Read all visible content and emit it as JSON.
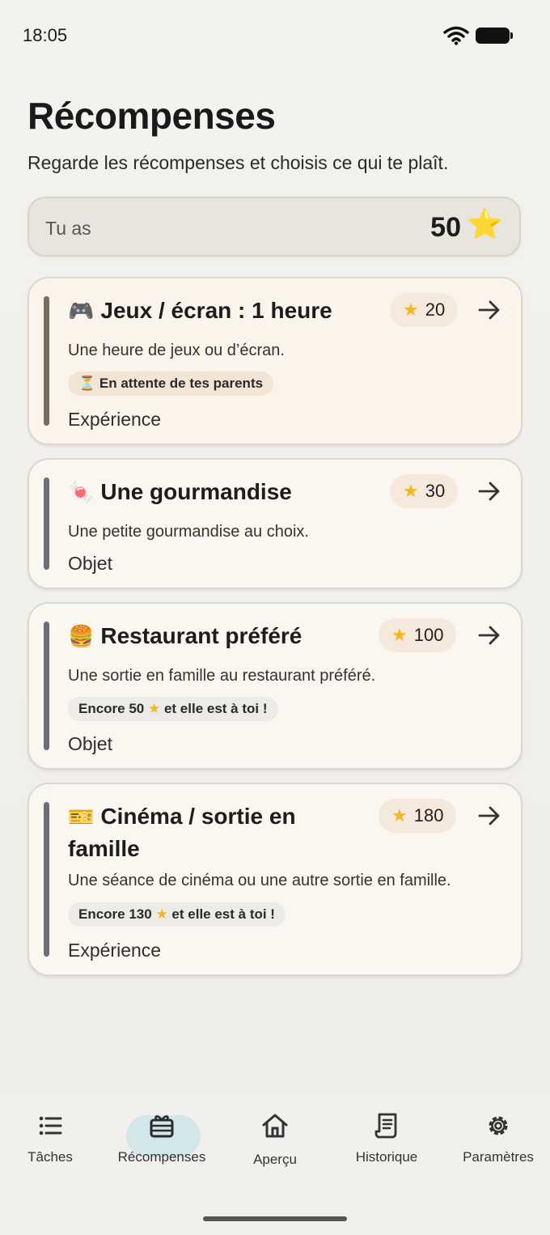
{
  "status_bar": {
    "time": "18:05"
  },
  "header": {
    "title": "Récompenses",
    "subtitle": "Regarde les récompenses et choisis ce qui te plaît."
  },
  "balance": {
    "label": "Tu as",
    "value": "50",
    "star": "⭐"
  },
  "rewards": [
    {
      "emoji": "🎮",
      "title": "Jeux / écran : 1 heure",
      "cost": "20",
      "description": "Une heure de jeux ou d’écran.",
      "status": "⏳ En attente de tes parents",
      "category": "Expérience"
    },
    {
      "emoji": "🍬",
      "title": "Une gourmandise",
      "cost": "30",
      "description": "Une petite gourmandise au choix.",
      "category": "Objet"
    },
    {
      "emoji": "🍔",
      "title": "Restaurant préféré",
      "cost": "100",
      "description": "Une sortie en famille au restaurant préféré.",
      "status_prefix": "Encore 50 ",
      "status_suffix": " et elle est à toi !",
      "category": "Objet"
    },
    {
      "emoji": "🎫",
      "title_line1": "Cinéma / sortie en",
      "title_line2": "famille",
      "cost": "180",
      "description": "Une séance de cinéma ou une autre sortie en famille.",
      "status_prefix": "Encore 130 ",
      "status_suffix": " et elle est à toi !",
      "category": "Expérience"
    }
  ],
  "bottom_nav": [
    {
      "label": "Tâches",
      "icon": "list-icon"
    },
    {
      "label": "Récompenses",
      "icon": "gift-icon",
      "active": true
    },
    {
      "label": "Aperçu",
      "icon": "home-icon"
    },
    {
      "label": "Historique",
      "icon": "receipt-icon"
    },
    {
      "label": "Paramètres",
      "icon": "gear-icon"
    }
  ],
  "colors": {
    "accent": "#d3e6ea",
    "star": "#f3b61c",
    "card": "#faf7f1"
  }
}
